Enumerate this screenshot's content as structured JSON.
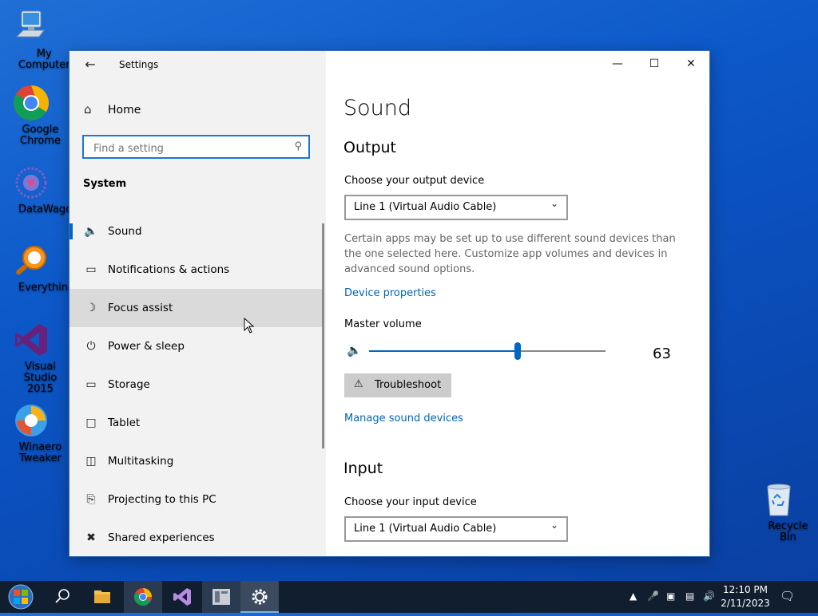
{
  "desktop": {
    "icons": [
      {
        "label": "My Computer",
        "icon": "computer-icon"
      },
      {
        "label": "Google Chrome",
        "icon": "chrome-icon"
      },
      {
        "label": "DataWagon...",
        "icon": "datawagon-icon"
      },
      {
        "label": "Everything",
        "icon": "everything-search-icon"
      },
      {
        "label": "Visual Studio 2015",
        "icon": "visual-studio-icon"
      },
      {
        "label": "Winaero Tweaker",
        "icon": "winaero-tweaker-icon"
      },
      {
        "label": "Recycle Bin",
        "icon": "recycle-bin-icon"
      }
    ]
  },
  "window": {
    "title": "Settings",
    "controls": {
      "minimize": "—",
      "maximize": "☐",
      "close": "✕"
    }
  },
  "sidebar": {
    "home": "Home",
    "search_placeholder": "Find a setting",
    "group": "System",
    "items": [
      {
        "label": "Sound",
        "icon": "speaker-icon",
        "selected": true
      },
      {
        "label": "Notifications & actions",
        "icon": "notification-icon"
      },
      {
        "label": "Focus assist",
        "icon": "moon-icon",
        "hovered": true
      },
      {
        "label": "Power & sleep",
        "icon": "power-icon"
      },
      {
        "label": "Storage",
        "icon": "storage-icon"
      },
      {
        "label": "Tablet",
        "icon": "tablet-icon"
      },
      {
        "label": "Multitasking",
        "icon": "multitasking-icon"
      },
      {
        "label": "Projecting to this PC",
        "icon": "projecting-icon"
      },
      {
        "label": "Shared experiences",
        "icon": "shared-experiences-icon"
      }
    ]
  },
  "main": {
    "title": "Sound",
    "output": {
      "heading": "Output",
      "device_label": "Choose your output device",
      "device_value": "Line 1 (Virtual Audio Cable)",
      "description": "Certain apps may be set up to use different sound devices than the one selected here. Customize app volumes and devices in advanced sound options.",
      "device_properties_link": "Device properties",
      "master_volume_label": "Master volume",
      "master_volume_value": "63",
      "troubleshoot_label": "Troubleshoot",
      "manage_link": "Manage sound devices"
    },
    "input": {
      "heading": "Input",
      "device_label": "Choose your input device",
      "device_value": "Line 1 (Virtual Audio Cable)"
    }
  },
  "taskbar": {
    "apps": [
      "start-icon",
      "search-icon",
      "file-explorer-icon",
      "chrome-icon",
      "visual-studio-icon",
      "app-icon",
      "settings-gear-icon"
    ],
    "active_app": "settings-gear-icon",
    "clock_time": "12:10 PM",
    "clock_date": "2/11/2023"
  },
  "colors": {
    "accent": "#0067c0",
    "link": "#0066b4",
    "desktop": "#0c58c9",
    "taskbar": "#101e30"
  }
}
